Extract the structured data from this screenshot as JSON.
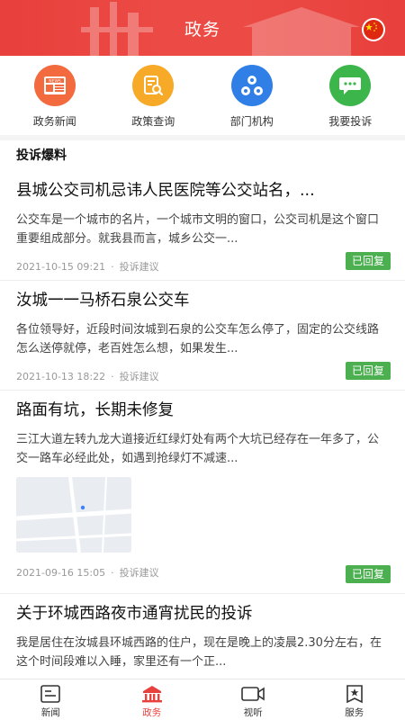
{
  "header": {
    "title": "政务"
  },
  "quicknav": [
    {
      "label": "政务新闻",
      "icon": "news-icon",
      "color": "#f26a3d"
    },
    {
      "label": "政策查询",
      "icon": "policy-search-icon",
      "color": "#f7a928"
    },
    {
      "label": "部门机构",
      "icon": "department-icon",
      "color": "#2f7fe6"
    },
    {
      "label": "我要投诉",
      "icon": "complaint-chat-icon",
      "color": "#3cb54a"
    }
  ],
  "section": {
    "title": "投诉爆料"
  },
  "posts": [
    {
      "title": "县城公交司机忌讳人民医院等公交站名，...",
      "summary": "公交车是一个城市的名片，一个城市文明的窗口，公交司机是这个窗口重要组成部分。就我县而言，城乡公交一...",
      "date": "2021-10-15 09:21",
      "category": "投诉建议",
      "status": "已回复"
    },
    {
      "title": "汝城一一马桥石泉公交车",
      "summary": "各位领导好，近段时间汝城到石泉的公交车怎么停了，固定的公交线路怎么送停就停，老百姓怎么想，如果发生...",
      "date": "2021-10-13 18:22",
      "category": "投诉建议",
      "status": "已回复"
    },
    {
      "title": "路面有坑，长期未修复",
      "summary": "三江大道左转九龙大道接近红绿灯处有两个大坑已经存在一年多了，公交一路车必经此处，如遇到抢绿灯不减速...",
      "date": "2021-09-16 15:05",
      "category": "投诉建议",
      "status": "已回复"
    },
    {
      "title": "关于环城西路夜市通宵扰民的投诉",
      "summary": "我是居住在汝城县环城西路的住户，现在是晚上的凌晨2.30分左右，在这个时间段难以入睡，家里还有一个正..."
    }
  ],
  "tabbar": [
    {
      "label": "新闻",
      "icon": "news-tab-icon"
    },
    {
      "label": "政务",
      "icon": "gov-tab-icon",
      "active": true
    },
    {
      "label": "视听",
      "icon": "video-tab-icon"
    },
    {
      "label": "服务",
      "icon": "service-tab-icon"
    }
  ],
  "colors": {
    "brand_red": "#e8403c",
    "status_green": "#4caf50"
  }
}
